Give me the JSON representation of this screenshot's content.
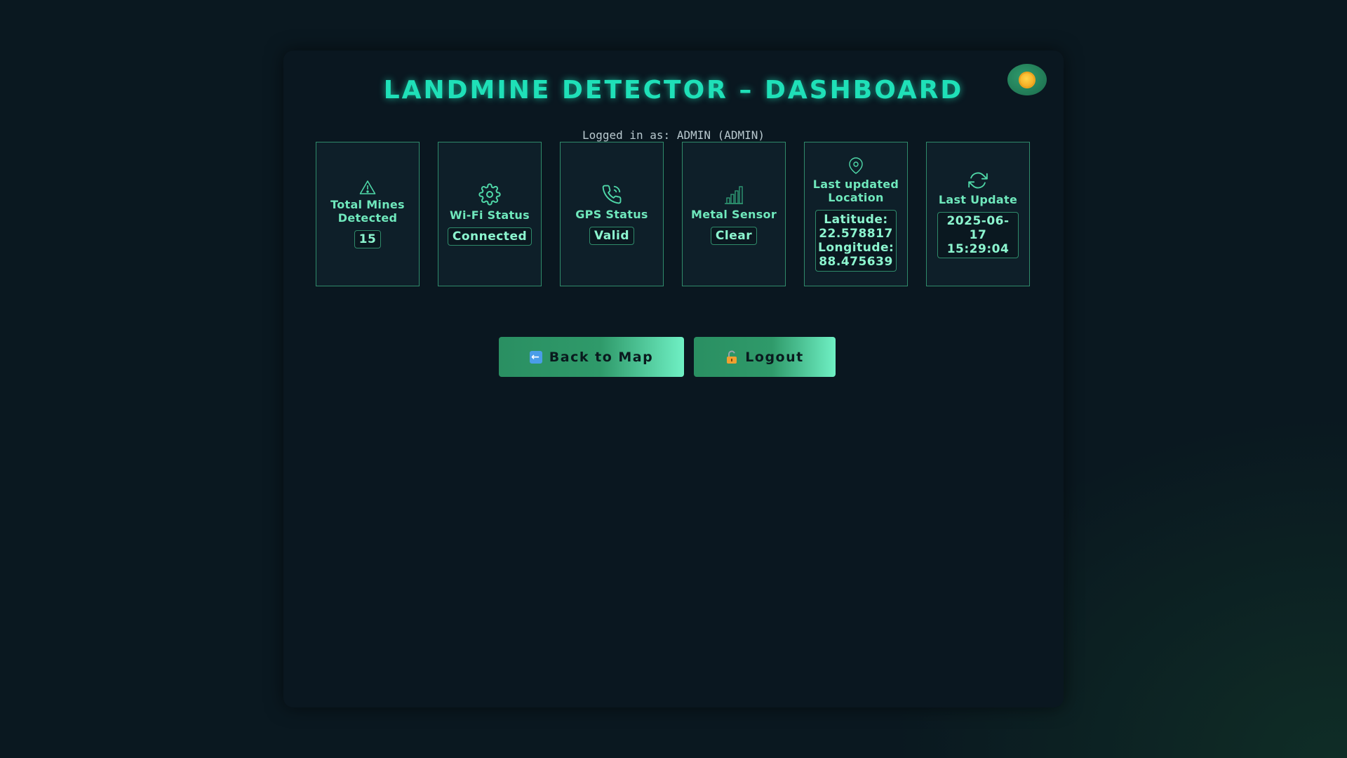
{
  "header": {
    "title": "LANDMINE DETECTOR – DASHBOARD",
    "logged_in_prefix": "Logged in as: ",
    "logged_in_user": "ADMIN (ADMIN)"
  },
  "theme_toggle": {
    "icon": "sun-icon"
  },
  "cards": [
    {
      "icon": "warning-triangle-icon",
      "label": "Total Mines Detected",
      "value": "15"
    },
    {
      "icon": "gear-icon",
      "label": "Wi-Fi Status",
      "value": "Connected"
    },
    {
      "icon": "phone-icon",
      "label": "GPS Status",
      "value": "Valid"
    },
    {
      "icon": "signal-bars-icon",
      "label": "Metal Sensor",
      "value": "Clear"
    },
    {
      "icon": "map-pin-icon",
      "label": "Last updated Location",
      "latitude_label": "Latitude:",
      "latitude": "22.578817",
      "longitude_label": "Longitude:",
      "longitude": "88.475639"
    },
    {
      "icon": "refresh-icon",
      "label": "Last Update",
      "value": "2025-06-17 15:29:04"
    }
  ],
  "buttons": {
    "back_label": "Back to Map",
    "back_icon": "left-arrow-icon",
    "logout_label": "Logout",
    "logout_icon": "unlock-icon"
  },
  "colors": {
    "accent": "#1fe0b8",
    "card_border": "#2f8a6a",
    "button_start": "#2a8f62",
    "button_end": "#6ff0c4"
  }
}
